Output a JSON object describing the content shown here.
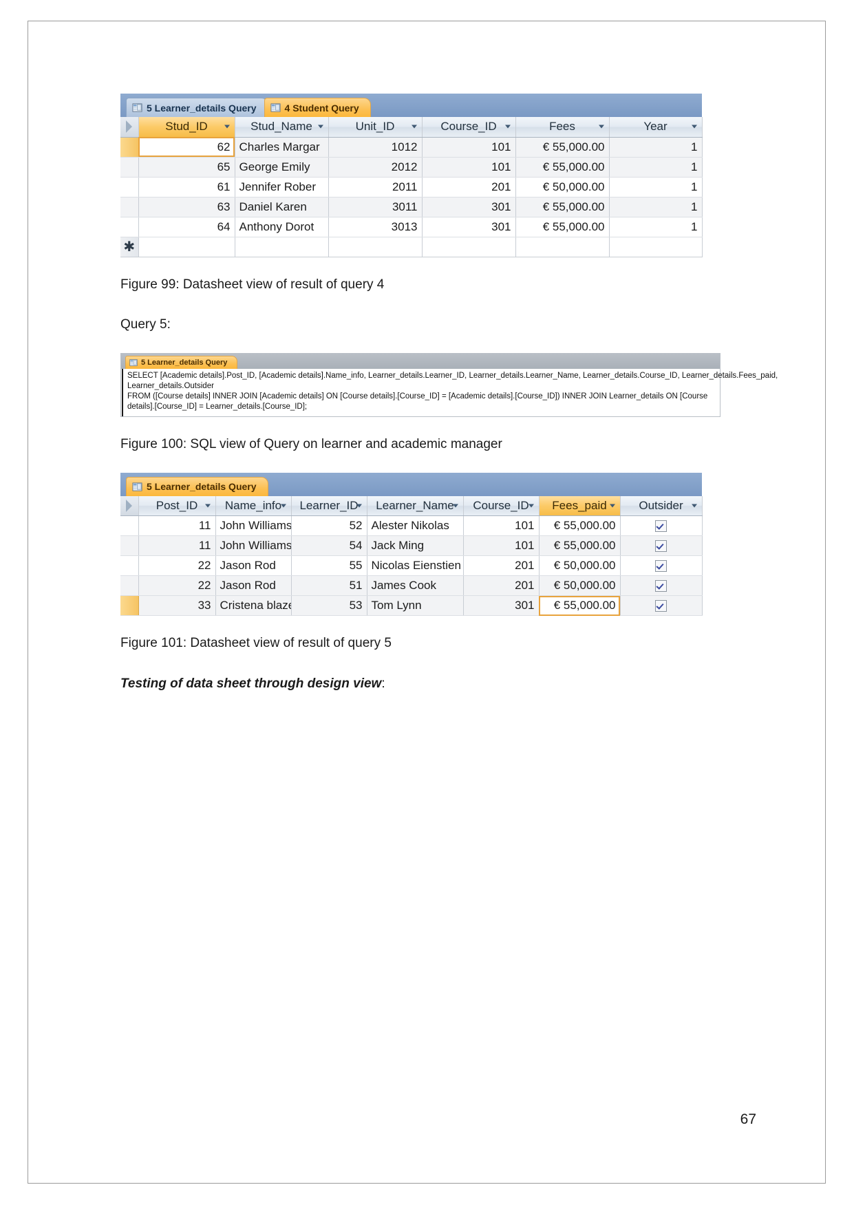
{
  "document": {
    "page_number": "67"
  },
  "query4_window": {
    "tabs": [
      {
        "label": "5 Learner_details Query",
        "state": "inactive",
        "icon": "query-datasheet-icon"
      },
      {
        "label": "4 Student Query",
        "state": "active",
        "icon": "query-datasheet-icon"
      }
    ],
    "columns": [
      "Stud_ID",
      "Stud_Name",
      "Unit_ID",
      "Course_ID",
      "Fees",
      "Year"
    ],
    "highlighted_column": "Stud_ID",
    "rows": [
      {
        "Stud_ID": "62",
        "Stud_Name": "Charles Margar",
        "Unit_ID": "1012",
        "Course_ID": "101",
        "Fees": "€ 55,000.00",
        "Year": "1"
      },
      {
        "Stud_ID": "65",
        "Stud_Name": "George Emily",
        "Unit_ID": "2012",
        "Course_ID": "101",
        "Fees": "€ 55,000.00",
        "Year": "1"
      },
      {
        "Stud_ID": "61",
        "Stud_Name": "Jennifer Rober",
        "Unit_ID": "2011",
        "Course_ID": "201",
        "Fees": "€ 50,000.00",
        "Year": "1"
      },
      {
        "Stud_ID": "63",
        "Stud_Name": "Daniel Karen",
        "Unit_ID": "3011",
        "Course_ID": "301",
        "Fees": "€ 55,000.00",
        "Year": "1"
      },
      {
        "Stud_ID": "64",
        "Stud_Name": "Anthony Dorot",
        "Unit_ID": "3013",
        "Course_ID": "301",
        "Fees": "€ 55,000.00",
        "Year": "1"
      }
    ],
    "new_record_marker": "✱"
  },
  "caption_99": "Figure 99: Datasheet view of result of query 4",
  "query5_label": "Query 5:",
  "sql_window": {
    "tab": {
      "label": "5 Learner_details Query",
      "icon": "query-sql-icon"
    },
    "lines": [
      "SELECT [Academic details].Post_ID, [Academic details].Name_info, Learner_details.Learner_ID, Learner_details.Learner_Name, Learner_details.Course_ID, Learner_details.Fees_paid,",
      "Learner_details.Outsider",
      "FROM ([Course details] INNER JOIN [Academic details] ON [Course details].[Course_ID] = [Academic details].[Course_ID]) INNER JOIN Learner_details ON [Course",
      "details].[Course_ID] = Learner_details.[Course_ID];"
    ]
  },
  "caption_100": "Figure 100: SQL view of Query on learner and academic manager",
  "query5_window": {
    "tab": {
      "label": "5 Learner_details Query",
      "state": "active",
      "icon": "query-datasheet-icon"
    },
    "columns": [
      "Post_ID",
      "Name_info",
      "Learner_ID",
      "Learner_Name",
      "Course_ID",
      "Fees_paid",
      "Outsider"
    ],
    "highlighted_column": "Fees_paid",
    "rows": [
      {
        "Post_ID": "11",
        "Name_info": "John Williams",
        "Learner_ID": "52",
        "Learner_Name": "Alester Nikolas",
        "Course_ID": "101",
        "Fees_paid": "€ 55,000.00",
        "Outsider": true
      },
      {
        "Post_ID": "11",
        "Name_info": "John Williams",
        "Learner_ID": "54",
        "Learner_Name": "Jack Ming",
        "Course_ID": "101",
        "Fees_paid": "€ 55,000.00",
        "Outsider": true
      },
      {
        "Post_ID": "22",
        "Name_info": "Jason Rod",
        "Learner_ID": "55",
        "Learner_Name": "Nicolas Eienstien",
        "Course_ID": "201",
        "Fees_paid": "€ 50,000.00",
        "Outsider": true
      },
      {
        "Post_ID": "22",
        "Name_info": "Jason Rod",
        "Learner_ID": "51",
        "Learner_Name": "James Cook",
        "Course_ID": "201",
        "Fees_paid": "€ 50,000.00",
        "Outsider": true
      },
      {
        "Post_ID": "33",
        "Name_info": "Cristena blaze",
        "Learner_ID": "53",
        "Learner_Name": "Tom Lynn",
        "Course_ID": "301",
        "Fees_paid": "€ 55,000.00",
        "Outsider": true
      }
    ]
  },
  "caption_101": "Figure 101: Datasheet view of result of query 5",
  "testing_heading": "Testing of data sheet through design view",
  "testing_heading_suffix": ":",
  "colors": {
    "tab_active": "#fcc053",
    "tab_inactive": "#aec3dd",
    "tabstrip": "#7d9ec7",
    "header_highlight": "#f7bd49",
    "focus_outline": "#e8a33d"
  }
}
